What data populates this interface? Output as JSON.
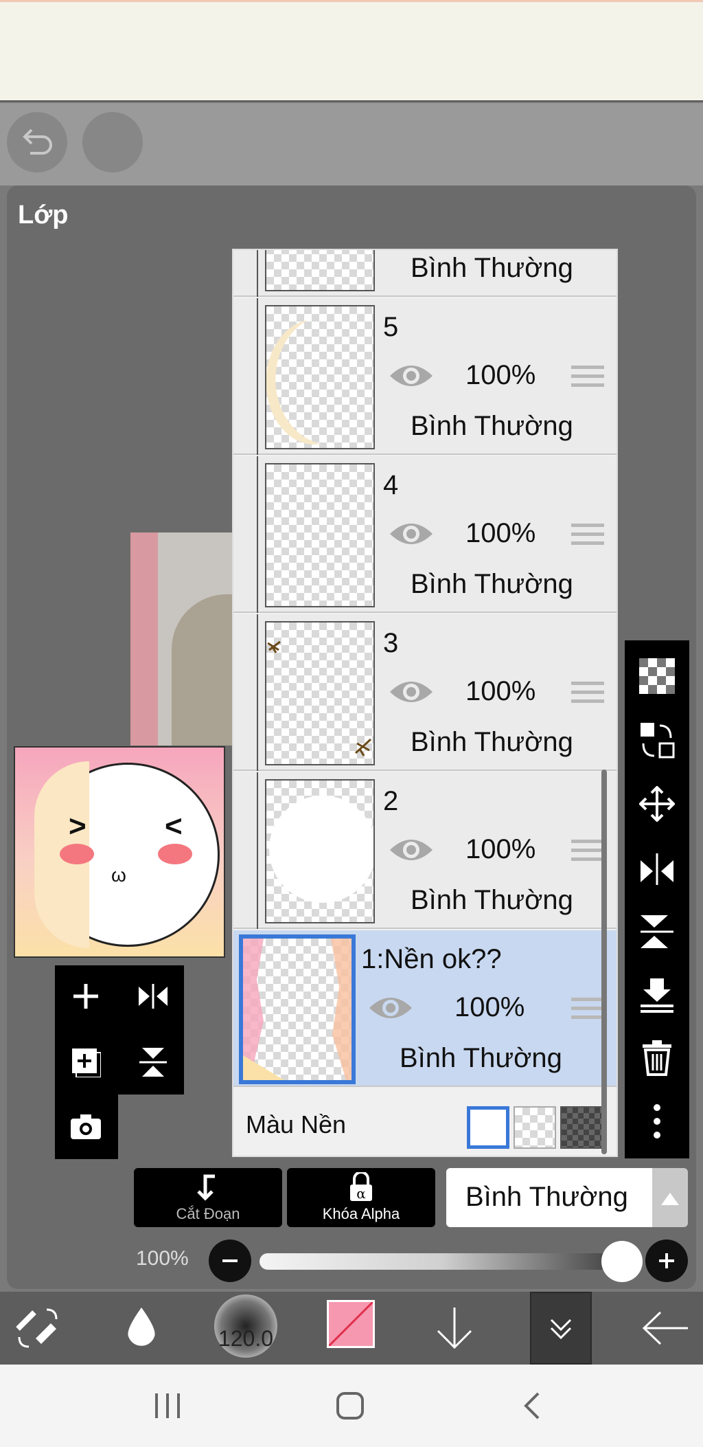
{
  "panel": {
    "title": "Lớp"
  },
  "layers": [
    {
      "name": "",
      "opacity": "",
      "blend": "Bình Thường",
      "visible": true
    },
    {
      "name": "5",
      "opacity": "100%",
      "blend": "Bình Thường",
      "visible": true
    },
    {
      "name": "4",
      "opacity": "100%",
      "blend": "Bình Thường",
      "visible": true
    },
    {
      "name": "3",
      "opacity": "100%",
      "blend": "Bình Thường",
      "visible": true
    },
    {
      "name": "2",
      "opacity": "100%",
      "blend": "Bình Thường",
      "visible": true
    },
    {
      "name": "1:Nền ok??",
      "opacity": "100%",
      "blend": "Bình Thường",
      "visible": true,
      "selected": true
    }
  ],
  "background_color": {
    "label": "Màu Nền",
    "options": [
      "white",
      "transparent",
      "dark"
    ],
    "selected": "white"
  },
  "actions": {
    "clipping": "Cắt Đoạn",
    "alpha_lock": "Khóa Alpha"
  },
  "blend_mode": {
    "value": "Bình Thường"
  },
  "opacity": {
    "label": "100%",
    "value": 100
  },
  "toolbar": {
    "brush_size": "120.0",
    "color": "#f598b0"
  },
  "colors": {
    "accent": "#3a78d8",
    "selected_row": "#c8d8f0",
    "panel": "#6b6b6b"
  }
}
